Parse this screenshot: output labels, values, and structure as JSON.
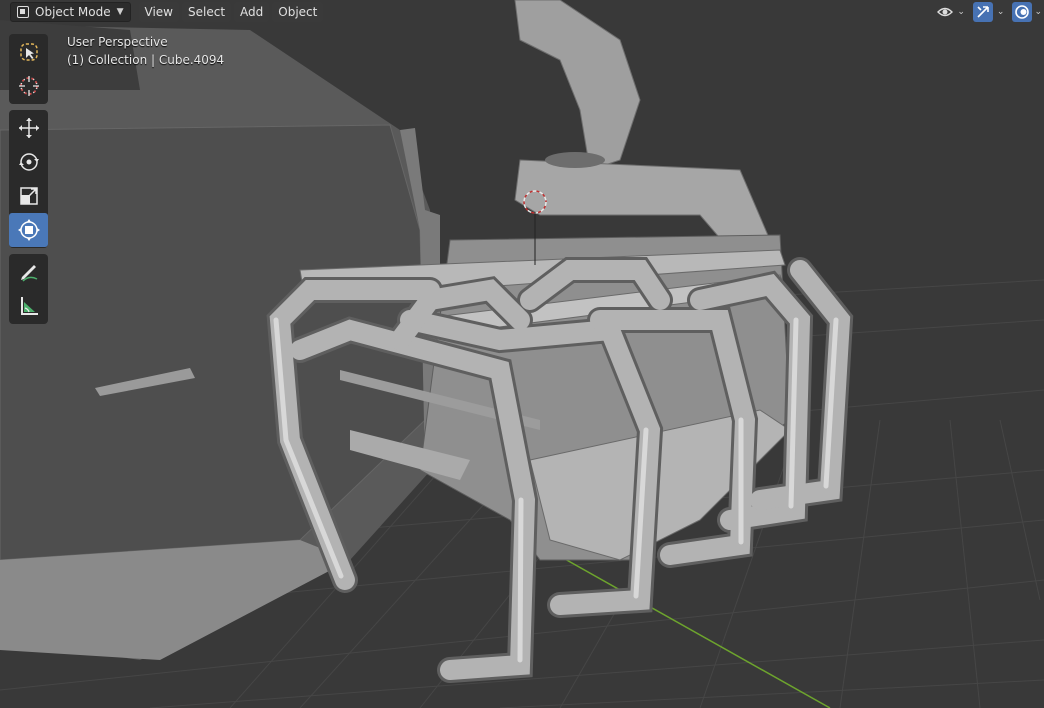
{
  "header": {
    "mode_label": "Object Mode",
    "menu": [
      "View",
      "Select",
      "Add",
      "Object"
    ]
  },
  "viewport_overlay": {
    "view_name": "User Perspective",
    "active_object": "(1) Collection | Cube.4094"
  },
  "toolbar": {
    "tools": [
      {
        "name": "select-box-tool",
        "icon": "select-box-icon",
        "active": false
      },
      {
        "name": "cursor-tool",
        "icon": "cursor-icon",
        "active": false
      },
      {
        "name": "move-tool",
        "icon": "move-icon",
        "active": false
      },
      {
        "name": "rotate-tool",
        "icon": "rotate-icon",
        "active": false
      },
      {
        "name": "scale-tool",
        "icon": "scale-icon",
        "active": false
      },
      {
        "name": "transform-tool",
        "icon": "transform-icon",
        "active": true
      },
      {
        "name": "annotate-tool",
        "icon": "annotate-icon",
        "active": false
      },
      {
        "name": "measure-tool",
        "icon": "measure-icon",
        "active": false
      }
    ]
  },
  "right_header_icons": [
    "visibility-icon",
    "gizmo-icon",
    "overlays-icon"
  ],
  "colors": {
    "background": "#393939",
    "grid": "#474747",
    "accent": "#4772b3",
    "y_axis": "#6da42d",
    "mesh": "#a8a8a8"
  }
}
